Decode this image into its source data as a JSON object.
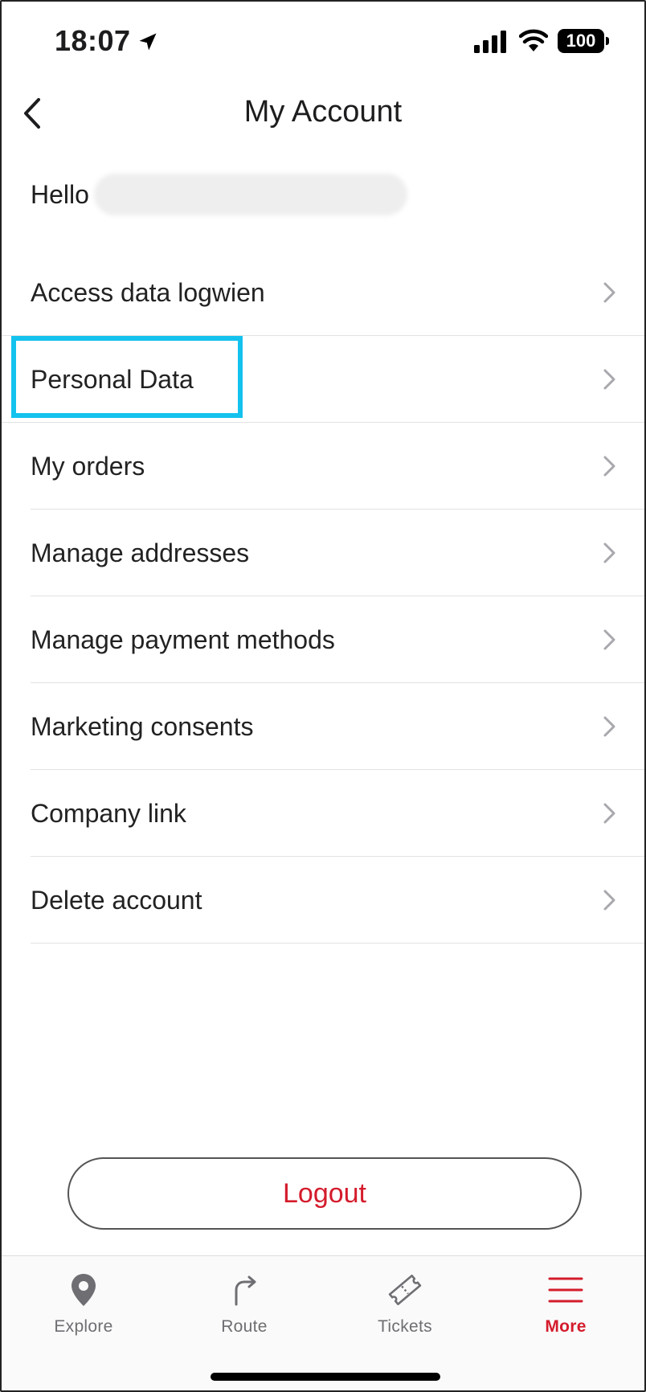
{
  "status_bar": {
    "time": "18:07",
    "battery": "100"
  },
  "header": {
    "title": "My Account"
  },
  "greeting": {
    "label": "Hello"
  },
  "menu": {
    "items": [
      {
        "label": "Access data logwien"
      },
      {
        "label": "Personal Data"
      },
      {
        "label": "My orders"
      },
      {
        "label": "Manage addresses"
      },
      {
        "label": "Manage payment methods"
      },
      {
        "label": "Marketing consents"
      },
      {
        "label": "Company link"
      },
      {
        "label": "Delete account"
      }
    ]
  },
  "logout": {
    "label": "Logout"
  },
  "tabs": [
    {
      "label": "Explore",
      "icon": "map-pin-icon"
    },
    {
      "label": "Route",
      "icon": "route-arrow-icon"
    },
    {
      "label": "Tickets",
      "icon": "ticket-icon"
    },
    {
      "label": "More",
      "icon": "hamburger-menu-icon",
      "active": true
    }
  ],
  "colors": {
    "accent": "#d41c2c",
    "highlight": "#14c2ee",
    "inactive_tab": "#6e6e73"
  }
}
